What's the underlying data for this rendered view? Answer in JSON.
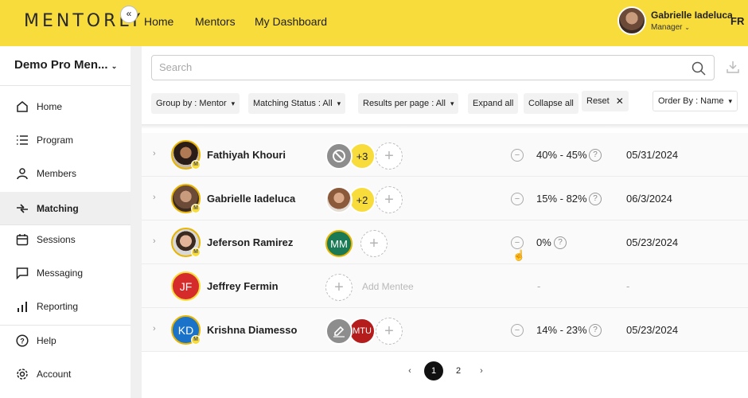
{
  "header": {
    "logo": "MENTORLY",
    "nav": [
      "Home",
      "Mentors",
      "My Dashboard"
    ],
    "user_name": "Gabrielle Iadeluca",
    "user_role": "Manager",
    "lang": "FR"
  },
  "sidebar": {
    "org_name": "Demo Pro Men...",
    "collapse": "«",
    "items": [
      {
        "label": "Home",
        "icon": "home-icon"
      },
      {
        "label": "Program",
        "icon": "list-icon"
      },
      {
        "label": "Members",
        "icon": "person-icon"
      },
      {
        "label": "Matching",
        "icon": "matching-icon",
        "active": true
      },
      {
        "label": "Sessions",
        "icon": "calendar-icon"
      },
      {
        "label": "Messaging",
        "icon": "chat-icon"
      },
      {
        "label": "Reporting",
        "icon": "bar-chart-icon"
      },
      {
        "label": "Help",
        "icon": "help-icon"
      },
      {
        "label": "Account",
        "icon": "gear-icon"
      }
    ]
  },
  "toolbar": {
    "search_placeholder": "Search",
    "group_by": "Group by : Mentor",
    "matching_status": "Matching Status : All",
    "results_per_page": "Results per page : All",
    "expand_all": "Expand all",
    "collapse_all": "Collapse all",
    "reset": "Reset",
    "order_by": "Order By : Name"
  },
  "rows": [
    {
      "name": "Fathiyah Khouri",
      "extra_count": "+3",
      "match": "40% - 45%",
      "date": "05/31/2024"
    },
    {
      "name": "Gabrielle Iadeluca",
      "extra_count": "+2",
      "match": "15% - 82%",
      "date": "06/3/2024"
    },
    {
      "name": "Jeferson Ramirez",
      "mentee_initials": "MM",
      "match": "0%",
      "date": "05/23/2024"
    },
    {
      "name": "Jeffrey Fermin",
      "initials": "JF",
      "add_mentee": "Add Mentee",
      "match": "-",
      "date": "-"
    },
    {
      "name": "Krishna Diamesso",
      "initials": "KD",
      "mentee_initials": "MTU",
      "match": "14% - 23%",
      "date": "05/23/2024"
    }
  ],
  "pagination": {
    "pages": [
      "1",
      "2"
    ],
    "current": "1"
  },
  "colors": {
    "brand": "#f8dc3c",
    "accent_gold": "#e8b400"
  }
}
